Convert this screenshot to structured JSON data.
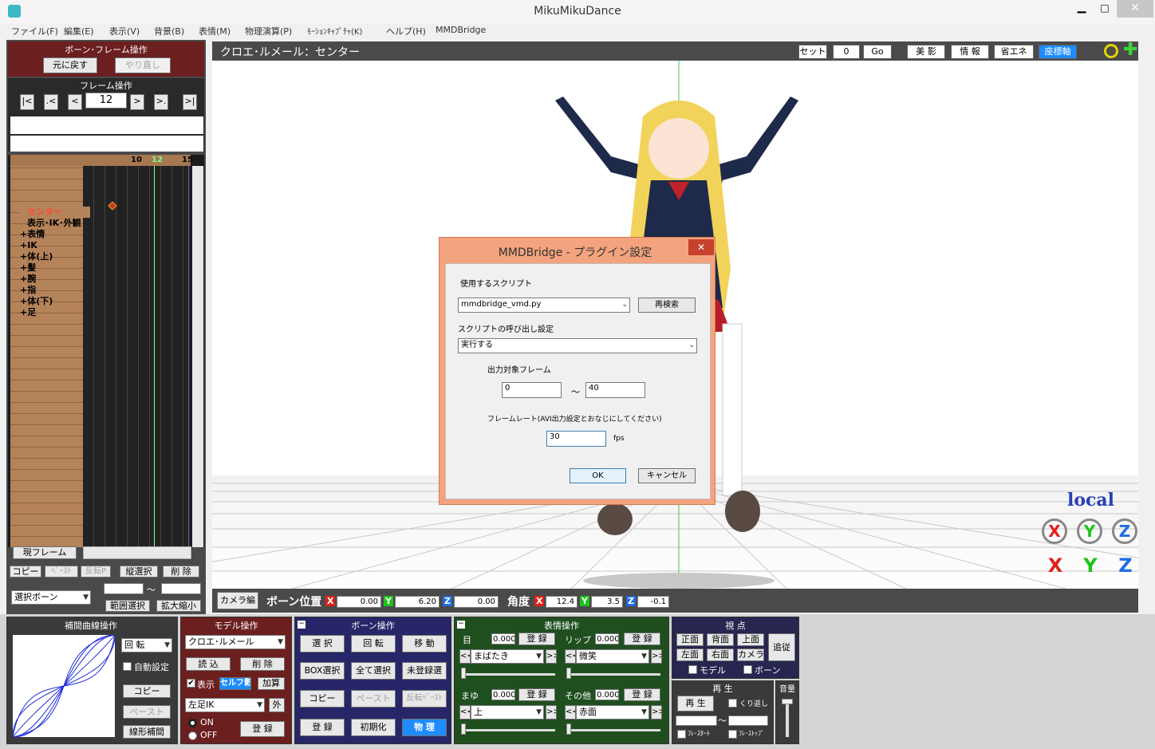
{
  "window": {
    "title": "MikuMikuDance"
  },
  "menu": [
    "ファイル(F)",
    "編集(E)",
    "表示(V)",
    "背景(B)",
    "表情(M)",
    "物理演算(P)",
    "ﾓｰｼｮﾝｷｬﾌﾟﾁｬ(K)",
    "ヘルプ(H)",
    "MMDBridge"
  ],
  "bone_frame": {
    "title": "ボーン･フレーム操作",
    "undo": "元に戻す",
    "redo": "やり直し"
  },
  "frame_ops": {
    "title": "フレーム操作",
    "first": "|<",
    "prev_key": ".<",
    "prev": "<",
    "frame": "12",
    "next": ">",
    "next_key": ">.",
    "last": ">|"
  },
  "timeline": {
    "ticks": [
      "10",
      "12",
      "15"
    ],
    "rows": [
      "センター",
      "表示･IK･外観",
      "+表情",
      "+IK",
      "+体(上)",
      "+髪",
      "+腕",
      "+指",
      "+体(下)",
      "+足"
    ],
    "current_frame_btn": "現フレーム"
  },
  "edit_ops": {
    "copy": "コピー",
    "paste": "ﾍﾟｰｽﾄ",
    "reverse": "反転P",
    "vsel": "縦選択",
    "delete": "削 除",
    "select_bone": "選択ボーン",
    "tilde": "～",
    "range_sel": "範囲選択",
    "scale": "拡大縮小"
  },
  "viewport_header": {
    "title": "クロエ･ルメール：センター",
    "set": "セット",
    "frame": "0",
    "go": "Go",
    "b1": "美 影",
    "b2": "情 報",
    "b3": "省エネ",
    "b4": "座標軸"
  },
  "axis_gizmo": {
    "local": "local",
    "x": "X",
    "y": "Y",
    "z": "Z"
  },
  "status": {
    "camera_btn": "カメラ編",
    "pos_label": "ボーン位置",
    "x": "X",
    "x_val": "0.00",
    "y": "Y",
    "y_val": "6.20",
    "z": "Z",
    "z_val": "0.00",
    "angle_label": "角度",
    "ax_val": "12.4",
    "ay_val": "3.5",
    "az_val": "-0.1"
  },
  "dialog": {
    "title": "MMDBridge - プラグイン設定",
    "close": "✕",
    "script_label": "使用するスクリプト",
    "script_value": "mmdbridge_vmd.py",
    "rescan": "再検索",
    "call_label": "スクリプトの呼び出し設定",
    "call_value": "実行する",
    "frames_label": "出力対象フレーム",
    "frame_from": "0",
    "tilde": "～",
    "frame_to": "40",
    "rate_label": "フレームレート(AVI出力設定とおなじにしてください)",
    "rate_value": "30",
    "fps": "fps",
    "ok": "OK",
    "cancel": "キャンセル"
  },
  "interp": {
    "title": "補間曲線操作",
    "rotation": "回 転",
    "auto": "自動設定",
    "copy": "コピー",
    "paste": "ペースト",
    "linear": "線形補間"
  },
  "model": {
    "title": "モデル操作",
    "model_name": "クロエ･ルメール",
    "load": "読 込",
    "delete": "削 除",
    "show": "表示",
    "self_shadow": "セルフ影",
    "add": "加算",
    "ik": "左足IK",
    "outer": "外",
    "on": "ON",
    "off": "OFF",
    "register": "登 録"
  },
  "bone_ops": {
    "title": "ボーン操作",
    "select": "選 択",
    "rotate": "回 転",
    "move": "移 動",
    "box": "BOX選択",
    "all": "全て選択",
    "unreg": "未登録選",
    "copy": "コピー",
    "paste": "ペースト",
    "rpaste": "反転ﾍﾟｰｽﾄ",
    "register": "登 録",
    "init": "初期化",
    "physics": "物 理"
  },
  "face_ops": {
    "title": "表情操作",
    "eye": "目",
    "eye_val": "0.000",
    "eye_sel": "まばたき",
    "lip": "リップ",
    "lip_val": "0.000",
    "lip_sel": "微笑",
    "brow": "まゆ",
    "brow_val": "0.000",
    "brow_sel": "上",
    "other": "その他",
    "other_val": "0.000",
    "other_sel": "赤面",
    "register": "登 録",
    "prev": "<<",
    "next": ">>"
  },
  "view": {
    "title": "視 点",
    "front": "正面",
    "back": "背面",
    "top": "上面",
    "left": "左面",
    "right": "右面",
    "camera": "カメラ",
    "follow": "追従",
    "model": "モデル",
    "bone": "ボーン"
  },
  "play": {
    "title": "再 生",
    "play": "再 生",
    "loop": "くり返し",
    "tilde": "～",
    "fstart": "ﾌﾚ･ｽﾀｰﾄ",
    "fstop": "ﾌﾚ･ｽﾄｯﾌﾟ",
    "volume": "音量"
  }
}
